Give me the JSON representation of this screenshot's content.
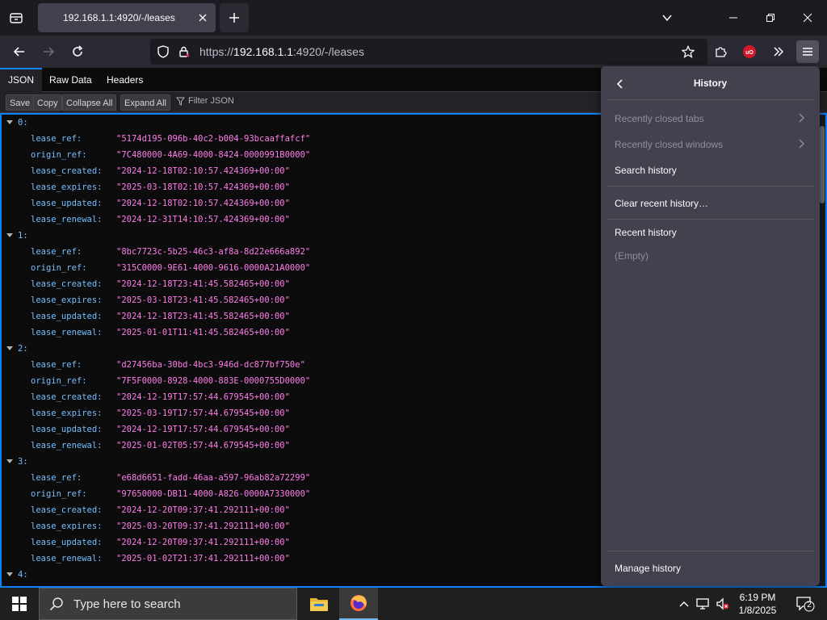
{
  "tab": {
    "title": "192.168.1.1:4920/-/leases"
  },
  "url": {
    "scheme": "https://",
    "host": "192.168.1.1",
    "rest": ":4920/-/leases"
  },
  "viewer": {
    "tabs": [
      "JSON",
      "Raw Data",
      "Headers"
    ],
    "buttons": [
      "Save",
      "Copy",
      "Collapse All",
      "Expand All"
    ],
    "filter_placeholder": "Filter JSON"
  },
  "leases": [
    {
      "index": "0:",
      "fields": [
        [
          "lease_ref:",
          "\"5174d195-096b-40c2-b004-93bcaaffafcf\""
        ],
        [
          "origin_ref:",
          "\"7C480000-4A69-4000-8424-0000991B0000\""
        ],
        [
          "lease_created:",
          "\"2024-12-18T02:10:57.424369+00:00\""
        ],
        [
          "lease_expires:",
          "\"2025-03-18T02:10:57.424369+00:00\""
        ],
        [
          "lease_updated:",
          "\"2024-12-18T02:10:57.424369+00:00\""
        ],
        [
          "lease_renewal:",
          "\"2024-12-31T14:10:57.424369+00:00\""
        ]
      ]
    },
    {
      "index": "1:",
      "fields": [
        [
          "lease_ref:",
          "\"8bc7723c-5b25-46c3-af8a-8d22e666a892\""
        ],
        [
          "origin_ref:",
          "\"315C0000-9E61-4000-9616-0000A21A0000\""
        ],
        [
          "lease_created:",
          "\"2024-12-18T23:41:45.582465+00:00\""
        ],
        [
          "lease_expires:",
          "\"2025-03-18T23:41:45.582465+00:00\""
        ],
        [
          "lease_updated:",
          "\"2024-12-18T23:41:45.582465+00:00\""
        ],
        [
          "lease_renewal:",
          "\"2025-01-01T11:41:45.582465+00:00\""
        ]
      ]
    },
    {
      "index": "2:",
      "fields": [
        [
          "lease_ref:",
          "\"d27456ba-30bd-4bc3-946d-dc877bf750e\""
        ],
        [
          "origin_ref:",
          "\"7F5F0000-8928-4000-883E-0000755D0000\""
        ],
        [
          "lease_created:",
          "\"2024-12-19T17:57:44.679545+00:00\""
        ],
        [
          "lease_expires:",
          "\"2025-03-19T17:57:44.679545+00:00\""
        ],
        [
          "lease_updated:",
          "\"2024-12-19T17:57:44.679545+00:00\""
        ],
        [
          "lease_renewal:",
          "\"2025-01-02T05:57:44.679545+00:00\""
        ]
      ]
    },
    {
      "index": "3:",
      "fields": [
        [
          "lease_ref:",
          "\"e68d6651-fadd-46aa-a597-96ab82a72299\""
        ],
        [
          "origin_ref:",
          "\"97650000-DB11-4000-A826-0000A7330000\""
        ],
        [
          "lease_created:",
          "\"2024-12-20T09:37:41.292111+00:00\""
        ],
        [
          "lease_expires:",
          "\"2025-03-20T09:37:41.292111+00:00\""
        ],
        [
          "lease_updated:",
          "\"2024-12-20T09:37:41.292111+00:00\""
        ],
        [
          "lease_renewal:",
          "\"2025-01-02T21:37:41.292111+00:00\""
        ]
      ]
    },
    {
      "index": "4:",
      "fields": []
    }
  ],
  "history_panel": {
    "title": "History",
    "recently_closed_tabs": "Recently closed tabs",
    "recently_closed_windows": "Recently closed windows",
    "search_history": "Search history",
    "clear_recent_history": "Clear recent history…",
    "recent_history": "Recent history",
    "empty": "(Empty)",
    "manage_history": "Manage history"
  },
  "taskbar": {
    "search_placeholder": "Type here to search",
    "time": "6:19 PM",
    "date": "1/8/2025",
    "notification_count": "2"
  },
  "colors": {
    "accent": "#0a84ff",
    "json_key": "#75bfff",
    "json_string": "#ff7de9",
    "ublock": "#d01a2b"
  }
}
